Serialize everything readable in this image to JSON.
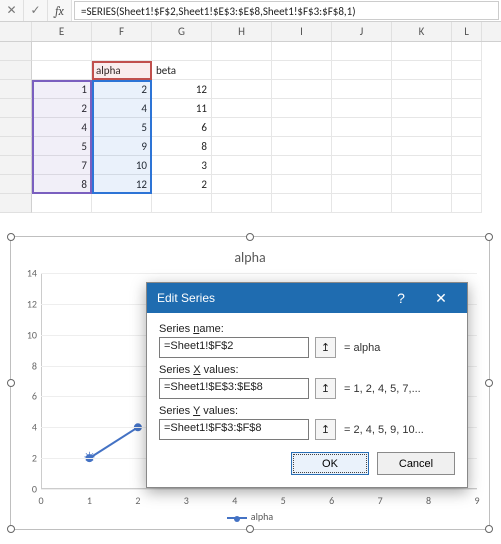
{
  "formula_bar": {
    "formula": "=SERIES(Sheet1!$F$2,Sheet1!$E$3:$E$8,Sheet1!$F$3:$F$8,1)"
  },
  "columns": [
    "E",
    "F",
    "G",
    "H",
    "I",
    "J",
    "K",
    "L"
  ],
  "headers": {
    "F": "alpha",
    "G": "beta"
  },
  "rows": [
    {
      "E": "1",
      "F": "2",
      "G": "12"
    },
    {
      "E": "2",
      "F": "4",
      "G": "11"
    },
    {
      "E": "4",
      "F": "5",
      "G": "6"
    },
    {
      "E": "5",
      "F": "9",
      "G": "8"
    },
    {
      "E": "7",
      "F": "10",
      "G": "3"
    },
    {
      "E": "8",
      "F": "12",
      "G": "2"
    }
  ],
  "chart_data": {
    "type": "line",
    "title": "alpha",
    "x": [
      1,
      2
    ],
    "xlim": [
      0,
      9
    ],
    "xticks": [
      0,
      1,
      2,
      3,
      4,
      5,
      6,
      7,
      8,
      9
    ],
    "ylim": [
      0,
      14
    ],
    "yticks": [
      0,
      2,
      4,
      6,
      8,
      10,
      12,
      14
    ],
    "series": [
      {
        "name": "alpha",
        "values": [
          2,
          4
        ],
        "color": "#4472c4"
      }
    ],
    "legend": "alpha"
  },
  "dialog": {
    "title": "Edit Series",
    "name_label": "Series name:",
    "name_value": "=Sheet1!$F$2",
    "name_result": "= alpha",
    "x_label": "Series X values:",
    "x_value": "=Sheet1!$E$3:$E$8",
    "x_result": "= 1, 2, 4, 5, 7,...",
    "y_label": "Series Y values:",
    "y_value": "=Sheet1!$F$3:$F$8",
    "y_result": "= 2, 4, 5, 9, 10...",
    "ok": "OK",
    "cancel": "Cancel"
  }
}
